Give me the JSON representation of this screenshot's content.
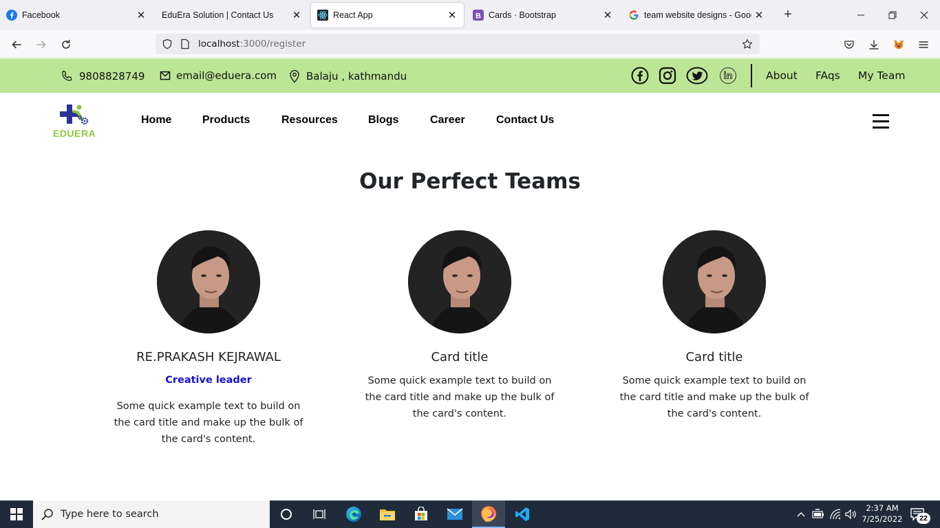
{
  "browser": {
    "tabs": [
      {
        "title": "Facebook",
        "favicon": "facebook-icon",
        "active": false
      },
      {
        "title": "EduEra Solution | Contact Us",
        "favicon": "none",
        "active": false
      },
      {
        "title": "React App",
        "favicon": "react-icon",
        "active": true
      },
      {
        "title": "Cards · Bootstrap",
        "favicon": "bootstrap-icon",
        "active": false
      },
      {
        "title": "team website designs - Google Search",
        "favicon": "google-icon",
        "active": false
      }
    ],
    "url_host": "localhost",
    "url_path": ":3000/register"
  },
  "topbar": {
    "phone": "9808828749",
    "email": "email@eduera.com",
    "location": "Balaju , kathmandu",
    "links": [
      "About",
      "FAqs",
      "My Team"
    ],
    "background": "#bde596"
  },
  "nav": {
    "logo_text": "EDUERA",
    "items": [
      "Home",
      "Products",
      "Resources",
      "Blogs",
      "Career",
      "Contact Us"
    ]
  },
  "team": {
    "title": "Our Perfect Teams",
    "cards": [
      {
        "name": "RE.PRAKASH KEJRAWAL",
        "role": "Creative leader",
        "text": "Some quick example text to build on the card title and make up the bulk of the card's content."
      },
      {
        "name": "Card title",
        "role": "",
        "text": "Some quick example text to build on the card title and make up the bulk of the card's content."
      },
      {
        "name": "Card title",
        "role": "",
        "text": "Some quick example text to build on the card title and make up the bulk of the card's content."
      }
    ]
  },
  "taskbar": {
    "search_placeholder": "Type here to search",
    "time": "2:37 AM",
    "date": "7/25/2022",
    "notification_count": "22"
  }
}
